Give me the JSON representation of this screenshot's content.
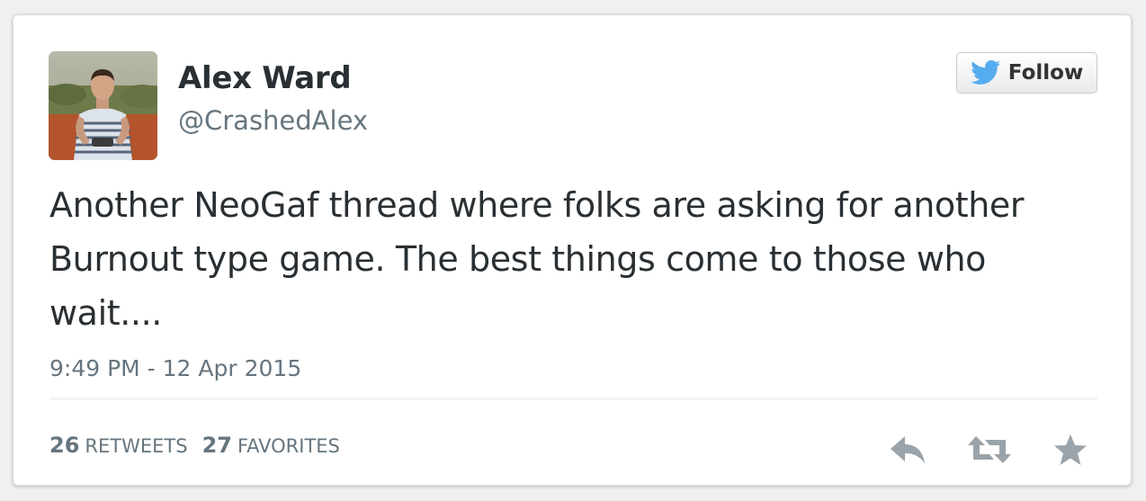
{
  "author": {
    "name": "Alex Ward",
    "handle": "@CrashedAlex",
    "avatar_icon": "profile-photo"
  },
  "follow_button": {
    "label": "Follow",
    "icon": "twitter-bird-icon",
    "icon_color": "#55acee"
  },
  "tweet": {
    "text": "Another NeoGaf thread where folks are asking for another Burnout type game. The best things come to those who wait....",
    "timestamp": "9:49 PM - 12 Apr 2015"
  },
  "stats": {
    "retweets_count": "26",
    "retweets_label": "RETWEETS",
    "favorites_count": "27",
    "favorites_label": "FAVORITES"
  },
  "actions": [
    {
      "name": "reply",
      "icon": "reply-icon"
    },
    {
      "name": "retweet",
      "icon": "retweet-icon"
    },
    {
      "name": "favorite",
      "icon": "star-icon"
    }
  ],
  "colors": {
    "text_primary": "#292f33",
    "text_secondary": "#66757f",
    "action_icon": "#9aa3aa"
  }
}
